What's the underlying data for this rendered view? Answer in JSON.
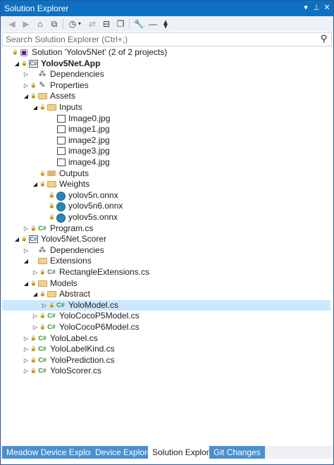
{
  "window": {
    "title": "Solution Explorer",
    "buttons": {
      "dropdown": "▾",
      "pin": "⊥",
      "close": "✕"
    }
  },
  "toolbar": {
    "icons": [
      "back-icon",
      "forward-icon",
      "home-icon",
      "switch-views-icon",
      "pending-changes-filter-icon",
      "sync-icon",
      "collapse-all-icon",
      "show-all-files-icon",
      "properties-icon",
      "preview-icon"
    ]
  },
  "search": {
    "placeholder": "Search Solution Explorer (Ctrl+;)",
    "value": ""
  },
  "colors": {
    "title_bar": "#0e70c0",
    "selection": "#cce8ff",
    "tab_bar": "#4a8fcf",
    "csharp": "#388a34"
  },
  "tree": [
    {
      "label": "Solution 'Yolov5Net' (2 of 2 projects)",
      "icon": "solution-icon",
      "caret": "none",
      "lock": true
    },
    {
      "label": "Yolov5Net.App",
      "icon": "csharp-project-icon",
      "caret": "expanded",
      "lock": true,
      "bold": true
    },
    {
      "label": "Dependencies",
      "icon": "dependencies-icon",
      "caret": "collapsed",
      "lock": false
    },
    {
      "label": "Properties",
      "icon": "properties-folder-icon",
      "caret": "collapsed",
      "lock": true
    },
    {
      "label": "Assets",
      "icon": "folder-open-icon",
      "caret": "expanded",
      "lock": true
    },
    {
      "label": "Inputs",
      "icon": "folder-open-icon",
      "caret": "expanded",
      "lock": true
    },
    {
      "label": "Image0.jpg",
      "icon": "image-file-icon",
      "caret": "none",
      "lock": false
    },
    {
      "label": "image1.jpg",
      "icon": "image-file-icon",
      "caret": "none",
      "lock": false
    },
    {
      "label": "image2.jpg",
      "icon": "image-file-icon",
      "caret": "none",
      "lock": false
    },
    {
      "label": "image3.jpg",
      "icon": "image-file-icon",
      "caret": "none",
      "lock": false
    },
    {
      "label": "image4.jpg",
      "icon": "image-file-icon",
      "caret": "none",
      "lock": false
    },
    {
      "label": "Outputs",
      "icon": "folder-icon",
      "caret": "none",
      "lock": true
    },
    {
      "label": "Weights",
      "icon": "folder-open-icon",
      "caret": "expanded",
      "lock": true
    },
    {
      "label": "yolov5n.onnx",
      "icon": "onnx-file-icon",
      "caret": "none",
      "lock": true
    },
    {
      "label": "yolov5n6.onnx",
      "icon": "onnx-file-icon",
      "caret": "none",
      "lock": true
    },
    {
      "label": "yolov5s.onnx",
      "icon": "onnx-file-icon",
      "caret": "none",
      "lock": true
    },
    {
      "label": "Program.cs",
      "icon": "csharp-file-icon",
      "caret": "collapsed",
      "lock": true
    },
    {
      "label": "Yolov5Net.Scorer",
      "icon": "csharp-project-icon",
      "caret": "expanded",
      "lock": true
    },
    {
      "label": "Dependencies",
      "icon": "dependencies-icon",
      "caret": "collapsed",
      "lock": false
    },
    {
      "label": "Extensions",
      "icon": "folder-open-icon",
      "caret": "expanded",
      "lock": false
    },
    {
      "label": "RectangleExtensions.cs",
      "icon": "csharp-file-icon",
      "caret": "collapsed",
      "lock": true
    },
    {
      "label": "Models",
      "icon": "folder-open-icon",
      "caret": "expanded",
      "lock": true
    },
    {
      "label": "Abstract",
      "icon": "folder-open-icon",
      "caret": "expanded",
      "lock": true
    },
    {
      "label": "YoloModel.cs",
      "icon": "csharp-file-icon",
      "caret": "collapsed",
      "lock": true,
      "selected": true
    },
    {
      "label": "YoloCocoP5Model.cs",
      "icon": "csharp-file-icon",
      "caret": "collapsed",
      "lock": true
    },
    {
      "label": "YoloCocoP6Model.cs",
      "icon": "csharp-file-icon",
      "caret": "collapsed",
      "lock": true
    },
    {
      "label": "YoloLabel.cs",
      "icon": "csharp-file-icon",
      "caret": "collapsed",
      "lock": true
    },
    {
      "label": "YoloLabelKind.cs",
      "icon": "csharp-file-icon",
      "caret": "collapsed",
      "lock": true
    },
    {
      "label": "YoloPrediction.cs",
      "icon": "csharp-file-icon",
      "caret": "collapsed",
      "lock": true
    },
    {
      "label": "YoloScorer.cs",
      "icon": "csharp-file-icon",
      "caret": "collapsed",
      "lock": true
    }
  ],
  "tabs": [
    {
      "label": "Meadow Device Explorer",
      "active": false
    },
    {
      "label": "Device Explorer",
      "active": false
    },
    {
      "label": "Solution Explorer",
      "active": true
    },
    {
      "label": "Git Changes",
      "active": false
    }
  ]
}
